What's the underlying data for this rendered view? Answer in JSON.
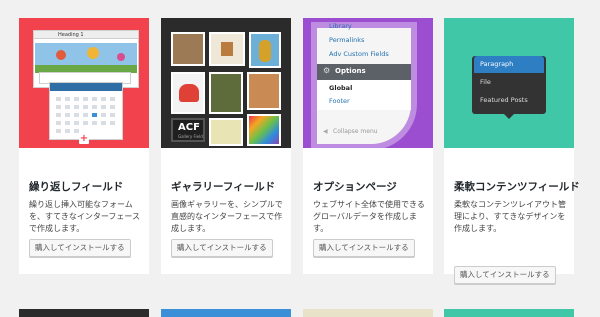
{
  "cards": [
    {
      "title": "繰り返しフィールド",
      "description": "繰り返し挿入可能なフォームを、すてきなインターフェースで作成します。",
      "button": "購入してインストールする",
      "thumb_color": "#f2424e",
      "thumb": {
        "editor_label": "Heading 1",
        "add_icon": "plus-icon"
      }
    },
    {
      "title": "ギャラリーフィールド",
      "description": "画像ギャラリーを、シンプルで直感的なインターフェースで作成します。",
      "button": "購入してインストールする",
      "thumb_color": "#2b2b2b",
      "thumb": {
        "logo": "ACF",
        "logo_sub": "Gallery Field"
      }
    },
    {
      "title": "オプションページ",
      "description": "ウェブサイト全体で使用できるグローバルデータを作成します。",
      "button": "購入してインストールする",
      "thumb_color": "#9b4fd0",
      "thumb": {
        "menu_top": "Library",
        "menu_permalinks": "Permalinks",
        "menu_fields": "Adv Custom Fields",
        "menu_options": "Options",
        "menu_global": "Global",
        "menu_footer": "Footer",
        "menu_collapse": "Collapse menu"
      }
    },
    {
      "title": "柔軟コンテンツフィールド",
      "description": "柔軟なコンテンツレイアウト管理により、すてきなデザインを作成します。",
      "button": "購入してインストールする",
      "thumb_color": "#3fc7a8",
      "thumb": {
        "items": [
          "Paragraph",
          "File",
          "Featured Posts"
        ]
      }
    }
  ],
  "row2_colors": [
    "#2b2b2b",
    "#3b8fd6",
    "#e8e2c8",
    "#3fc7a8"
  ]
}
